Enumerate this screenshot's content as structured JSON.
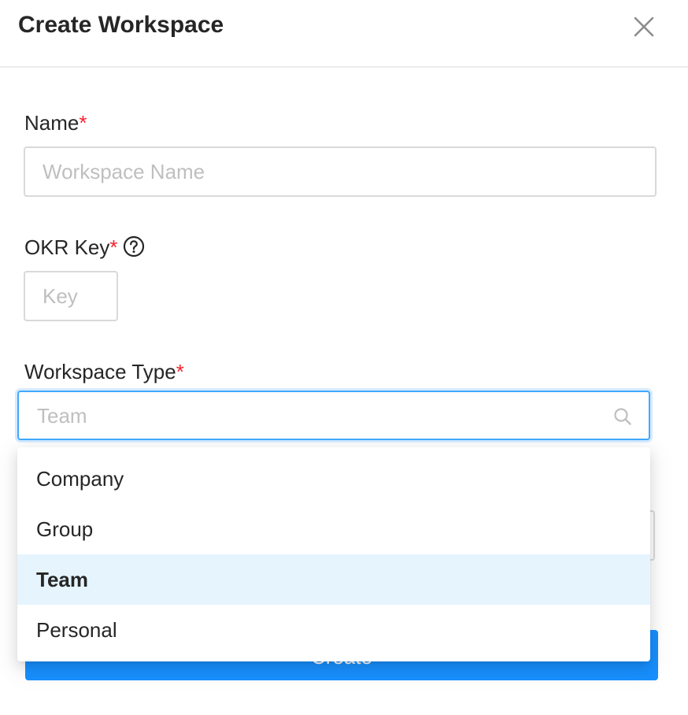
{
  "modal": {
    "title": "Create Workspace",
    "close_icon": "close-icon"
  },
  "form": {
    "name": {
      "label": "Name",
      "required_mark": "*",
      "placeholder": "Workspace Name",
      "value": ""
    },
    "okr_key": {
      "label": "OKR Key",
      "required_mark": "*",
      "help_icon": "question-circle-icon",
      "placeholder": "Key",
      "value": ""
    },
    "workspace_type": {
      "label": "Workspace Type",
      "required_mark": "*",
      "display_value": "Team",
      "search_icon": "search-icon",
      "options": [
        {
          "label": "Company",
          "selected": false
        },
        {
          "label": "Group",
          "selected": false
        },
        {
          "label": "Team",
          "selected": true
        },
        {
          "label": "Personal",
          "selected": false
        }
      ]
    },
    "submit_label": "Create"
  },
  "colors": {
    "accent": "#1890ff",
    "required": "#f5222d",
    "option_selected_bg": "#e6f4fe",
    "focus_border": "#40a9ff",
    "placeholder": "#bfbfbf"
  }
}
